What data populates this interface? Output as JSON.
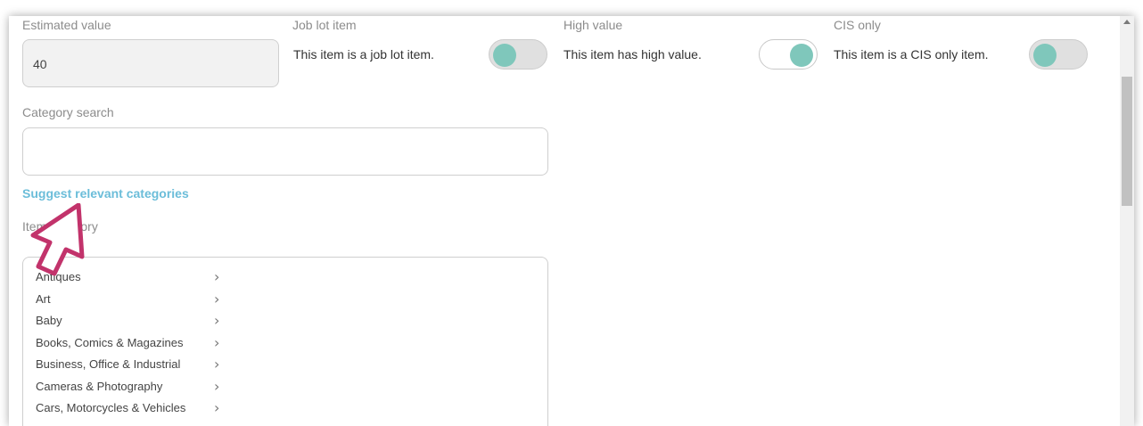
{
  "fields": {
    "estimated_value": {
      "label": "Estimated value",
      "value": "40"
    },
    "job_lot": {
      "label": "Job lot item",
      "text": "This item is a job lot item.",
      "on": false
    },
    "high_value": {
      "label": "High value",
      "text": "This item has high value.",
      "on": true
    },
    "cis_only": {
      "label": "CIS only",
      "text": "This item is a CIS only item.",
      "on": false
    },
    "category_search": {
      "label": "Category search",
      "value": ""
    },
    "suggest_link": "Suggest relevant categories",
    "item_category": {
      "label": "Item category"
    }
  },
  "categories": [
    {
      "label": "Antiques"
    },
    {
      "label": "Art"
    },
    {
      "label": "Baby"
    },
    {
      "label": "Books, Comics & Magazines"
    },
    {
      "label": "Business, Office & Industrial"
    },
    {
      "label": "Cameras & Photography"
    },
    {
      "label": "Cars, Motorcycles & Vehicles"
    }
  ],
  "chevron": "›",
  "colors": {
    "accent_link": "#6bbdd9",
    "toggle_knob": "#7fc7bb",
    "cursor": "#c2336b"
  },
  "icons": {
    "cursor": "pointer-arrow-icon",
    "chevron": "chevron-right-icon",
    "scroll_up": "scroll-up-arrow-icon"
  }
}
